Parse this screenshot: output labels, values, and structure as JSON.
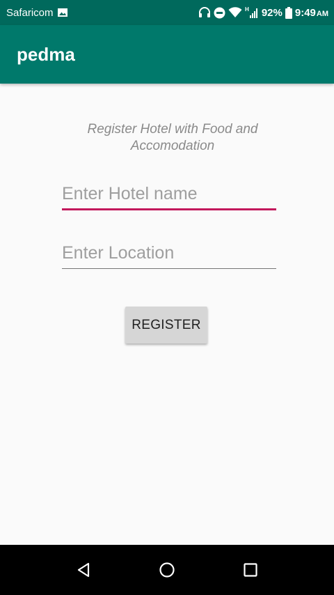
{
  "status_bar": {
    "carrier": "Safaricom",
    "network_type": "H",
    "battery": "92%",
    "time": "9:49",
    "ampm": "AM",
    "icons": [
      "image-icon",
      "headphones-icon",
      "do-not-disturb-icon",
      "wifi-icon",
      "signal-icon",
      "battery-icon"
    ]
  },
  "app_bar": {
    "title": "pedma"
  },
  "form": {
    "subtitle": "Register Hotel with Food and Accomodation",
    "hotel_name_placeholder": "Enter Hotel name",
    "location_placeholder": "Enter Location",
    "register_label": "REGISTER"
  },
  "nav_bar": {
    "icons": [
      "back-icon",
      "home-icon",
      "recents-icon"
    ]
  },
  "colors": {
    "status_bar": "#00695c",
    "app_bar": "#00796b",
    "accent": "#c2185b",
    "background": "#fafafa"
  }
}
